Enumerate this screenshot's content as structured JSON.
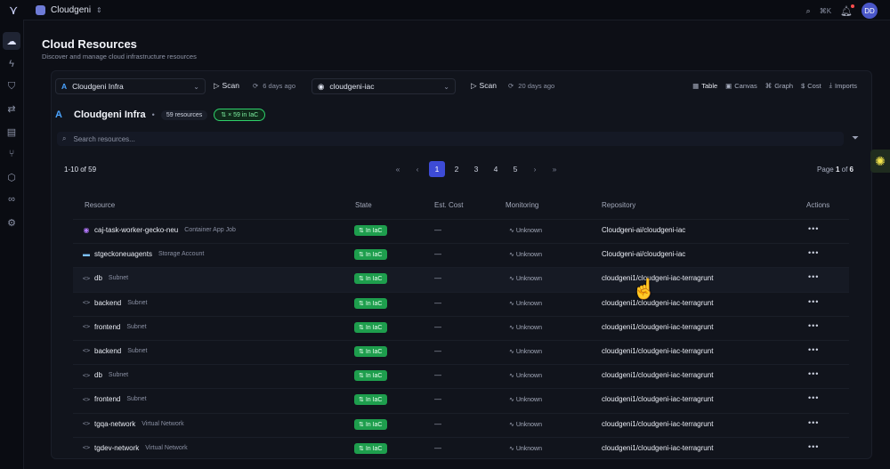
{
  "topbar": {
    "org_name": "Cloudgeni",
    "shortcut": "⌘K",
    "avatar_initials": "DD"
  },
  "header": {
    "title": "Cloud Resources",
    "subtitle": "Discover and manage cloud infrastructure resources"
  },
  "toolbar": {
    "infra_select": "Cloudgeni Infra",
    "scan_label": "Scan",
    "infra_scan_age": "6 days ago",
    "repo_select": "cloudgeni-iac",
    "repo_scan_age": "20 days ago",
    "views": [
      "Table",
      "Canvas",
      "Graph",
      "Cost",
      "Imports"
    ]
  },
  "infra": {
    "name": "Cloudgeni Infra",
    "resource_count": "59 resources",
    "iac_badge": "⇅ × 59 in IaC"
  },
  "search": {
    "placeholder": "Search resources..."
  },
  "pagination": {
    "range": "1-10 of 59",
    "pages": [
      "1",
      "2",
      "3",
      "4",
      "5"
    ],
    "current_page": "1",
    "page_label": "Page",
    "page_of": "of",
    "page_current": "1",
    "page_total": "6"
  },
  "table": {
    "columns": [
      "Resource",
      "State",
      "Est. Cost",
      "Monitoring",
      "Repository",
      "Actions"
    ],
    "rows": [
      {
        "name": "caj-task-worker-gecko-neu",
        "type": "Container App Job",
        "icon": "container-app-icon",
        "state": "In IaC",
        "cost": "—",
        "monitoring": "Unknown",
        "repo": "Cloudgeni-ai/cloudgeni-iac"
      },
      {
        "name": "stgeckoneuagents",
        "type": "Storage Account",
        "icon": "storage-account-icon",
        "state": "In IaC",
        "cost": "—",
        "monitoring": "Unknown",
        "repo": "Cloudgeni-ai/cloudgeni-iac"
      },
      {
        "name": "db",
        "type": "Subnet",
        "icon": "code-icon",
        "state": "In IaC",
        "cost": "—",
        "monitoring": "Unknown",
        "repo": "cloudgeni1/cloudgeni-iac-terragrunt"
      },
      {
        "name": "backend",
        "type": "Subnet",
        "icon": "code-icon",
        "state": "In IaC",
        "cost": "—",
        "monitoring": "Unknown",
        "repo": "cloudgeni1/cloudgeni-iac-terragrunt"
      },
      {
        "name": "frontend",
        "type": "Subnet",
        "icon": "code-icon",
        "state": "In IaC",
        "cost": "—",
        "monitoring": "Unknown",
        "repo": "cloudgeni1/cloudgeni-iac-terragrunt"
      },
      {
        "name": "backend",
        "type": "Subnet",
        "icon": "code-icon",
        "state": "In IaC",
        "cost": "—",
        "monitoring": "Unknown",
        "repo": "cloudgeni1/cloudgeni-iac-terragrunt"
      },
      {
        "name": "db",
        "type": "Subnet",
        "icon": "code-icon",
        "state": "In IaC",
        "cost": "—",
        "monitoring": "Unknown",
        "repo": "cloudgeni1/cloudgeni-iac-terragrunt"
      },
      {
        "name": "frontend",
        "type": "Subnet",
        "icon": "code-icon",
        "state": "In IaC",
        "cost": "—",
        "monitoring": "Unknown",
        "repo": "cloudgeni1/cloudgeni-iac-terragrunt"
      },
      {
        "name": "tgqa-network",
        "type": "Virtual Network",
        "icon": "code-icon",
        "state": "In IaC",
        "cost": "—",
        "monitoring": "Unknown",
        "repo": "cloudgeni1/cloudgeni-iac-terragrunt"
      },
      {
        "name": "tgdev-network",
        "type": "Virtual Network",
        "icon": "code-icon",
        "state": "In IaC",
        "cost": "—",
        "monitoring": "Unknown",
        "repo": "cloudgeni1/cloudgeni-iac-terragrunt"
      }
    ],
    "actions_glyph": "•••"
  },
  "colors": {
    "accent": "#3d4bd6",
    "iac_green": "#1e9e4d",
    "background": "#0d0f16"
  }
}
